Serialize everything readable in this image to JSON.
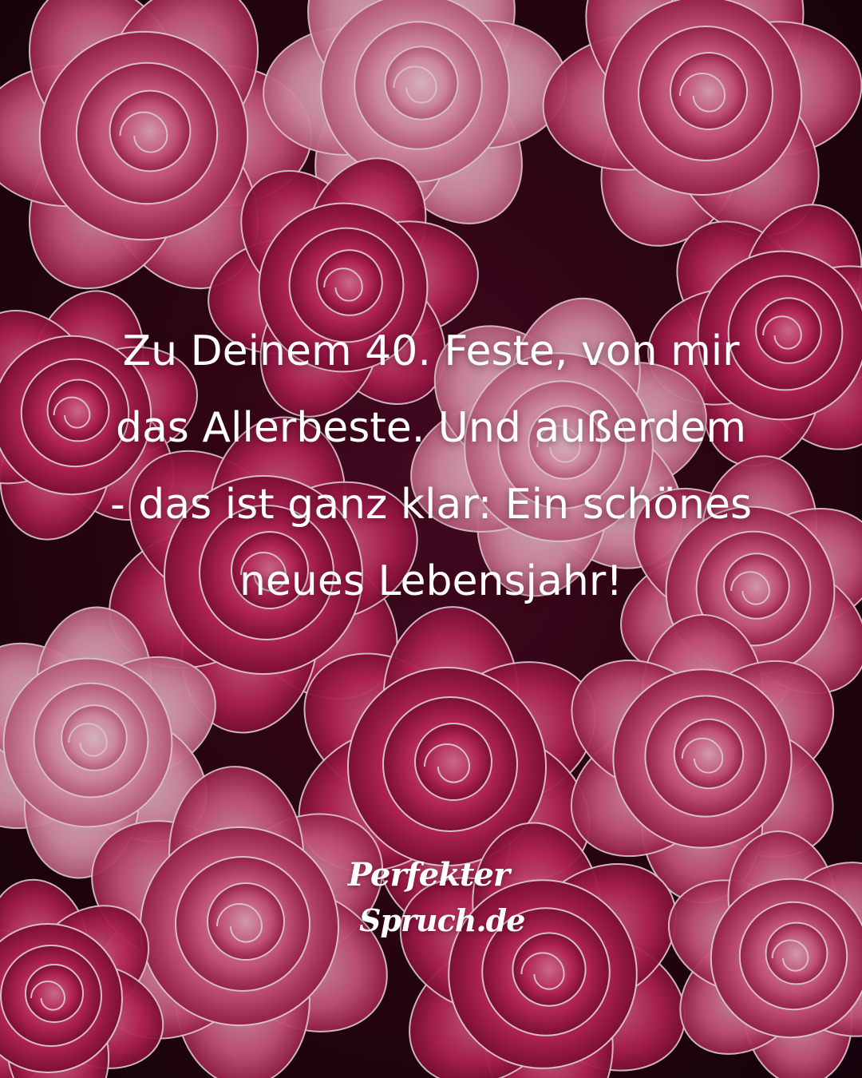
{
  "quote": {
    "lines": [
      "Zu Deinem 40. Feste, von mir",
      "das Allerbeste. Und außerdem",
      "- das ist ganz klar: Ein schönes",
      "neues Lebensjahr!"
    ]
  },
  "logo": {
    "line1": "Perfekter",
    "line2": "Spruch.de"
  },
  "colors": {
    "background": "#22040f",
    "rose_pink": "#e0507f",
    "rose_light": "#f3a6bf",
    "rose_deep": "#b8134f",
    "text": "#ffffff"
  }
}
